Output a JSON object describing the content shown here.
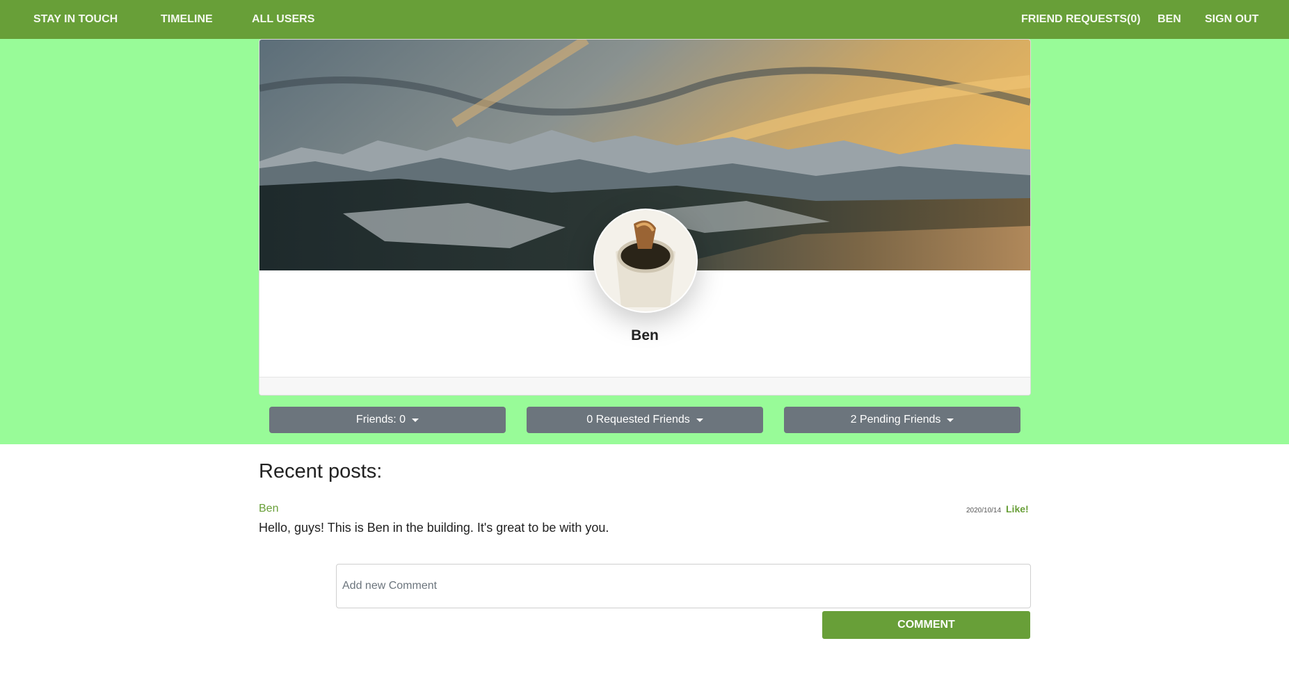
{
  "nav": {
    "brand": "STAY IN TOUCH",
    "timeline": "TIMELINE",
    "all_users": "ALL USERS",
    "friend_requests": "FRIEND REQUESTS(0)",
    "user": "BEN",
    "sign_out": "SIGN OUT"
  },
  "profile": {
    "name": "Ben",
    "cover_image": "mountain-landscape-sunset",
    "avatar_image": "coffee-cup"
  },
  "dropdowns": {
    "friends": "Friends: 0",
    "requested": "0 Requested Friends",
    "pending": "2 Pending Friends"
  },
  "posts": {
    "heading": "Recent posts:",
    "items": [
      {
        "author": "Ben",
        "date": "2020/10/14",
        "like_label": "Like!",
        "body": "Hello, guys! This is Ben in the building. It's great to be with you."
      }
    ]
  },
  "comment": {
    "placeholder": "Add new Comment",
    "value": "",
    "button": "COMMENT"
  },
  "colors": {
    "primary": "#689f38",
    "band": "#98fb98",
    "secondary": "#6c757d"
  }
}
